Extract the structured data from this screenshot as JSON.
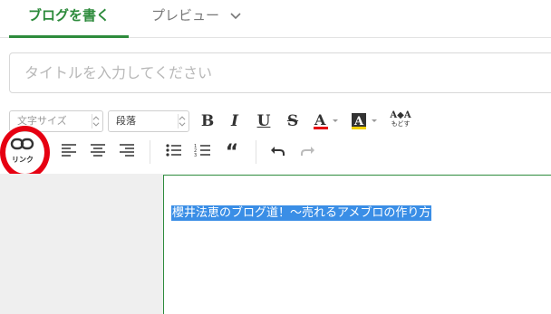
{
  "tabs": {
    "write_label": "ブログを書く",
    "preview_label": "プレビュー"
  },
  "title_field": {
    "placeholder": "タイトルを入力してください",
    "value": ""
  },
  "toolbar": {
    "font_size_value": "文字サイズ",
    "paragraph_value": "段落",
    "bold": "B",
    "italic": "I",
    "underline": "U",
    "strike": "S",
    "font_color": "A",
    "bg_color": "A",
    "undo_format_top": "A◆A",
    "undo_format_bottom": "もどす",
    "link_label": "リンク",
    "quote": "“"
  },
  "editor": {
    "selected_text": "櫻井法恵のブログ道！～売れるアメブロの作り方"
  },
  "colors": {
    "accent": "#2d8b3c",
    "highlight": "#e60012",
    "selection": "#3a8ee6",
    "font_color_bar": "#e60012",
    "bg_color_bar": "#f0d000"
  },
  "icons": [
    "link-icon",
    "align-left-icon",
    "align-center-icon",
    "align-right-icon",
    "bullet-list-icon",
    "numbered-list-icon",
    "quote-icon",
    "undo-icon",
    "redo-icon",
    "chevron-down-icon"
  ]
}
